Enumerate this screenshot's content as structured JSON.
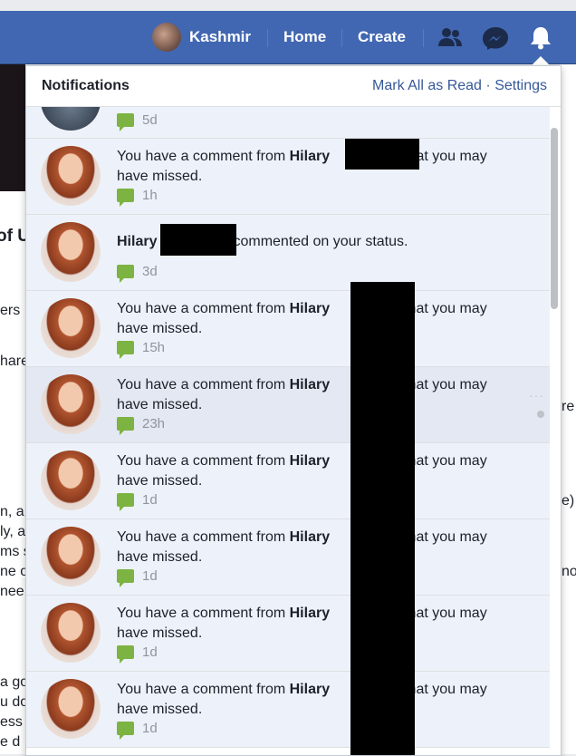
{
  "header": {
    "profile_name": "Kashmir",
    "nav_home": "Home",
    "nav_create": "Create",
    "icons": [
      "friends-icon",
      "messenger-icon",
      "notifications-bell-icon"
    ]
  },
  "background": {
    "left_fragments": [
      "of U",
      "ers",
      "hare",
      "n, a",
      "ly, a",
      "ms s",
      "ne o",
      " nee",
      "a go",
      "u do",
      "ess",
      "e d"
    ],
    "right_fragments": [
      "re",
      "e)",
      "no"
    ]
  },
  "notifications": {
    "title": "Notifications",
    "mark_all": "Mark All as Read",
    "separator": "·",
    "settings": "Settings",
    "items": [
      {
        "time": "5d"
      },
      {
        "pre": "You have a comment from ",
        "name": "Hilary",
        "post": "that you may have missed.",
        "time": "1h"
      },
      {
        "pre": "",
        "name": "Hilary",
        "post": "commented on your status.",
        "time": "3d"
      },
      {
        "pre": "You have a comment from ",
        "name": "Hilary",
        "post": "that you may have missed.",
        "time": "15h"
      },
      {
        "pre": "You have a comment from ",
        "name": "Hilary",
        "post": "that you may have missed.",
        "time": "23h"
      },
      {
        "pre": "You have a comment from ",
        "name": "Hilary",
        "post": "that you may have missed.",
        "time": "1d"
      },
      {
        "pre": "You have a comment from ",
        "name": "Hilary",
        "post": "that you may have missed.",
        "time": "1d"
      },
      {
        "pre": "You have a comment from ",
        "name": "Hilary",
        "post": "that you may have missed.",
        "time": "1d"
      },
      {
        "pre": "You have a comment from ",
        "name": "Hilary",
        "post": "that you may have missed.",
        "time": "1d"
      }
    ],
    "more_options": "···"
  },
  "colors": {
    "brand": "#4267b2",
    "unread_bg": "#edf2fa",
    "comment_icon": "#7cb342",
    "link": "#365899"
  }
}
